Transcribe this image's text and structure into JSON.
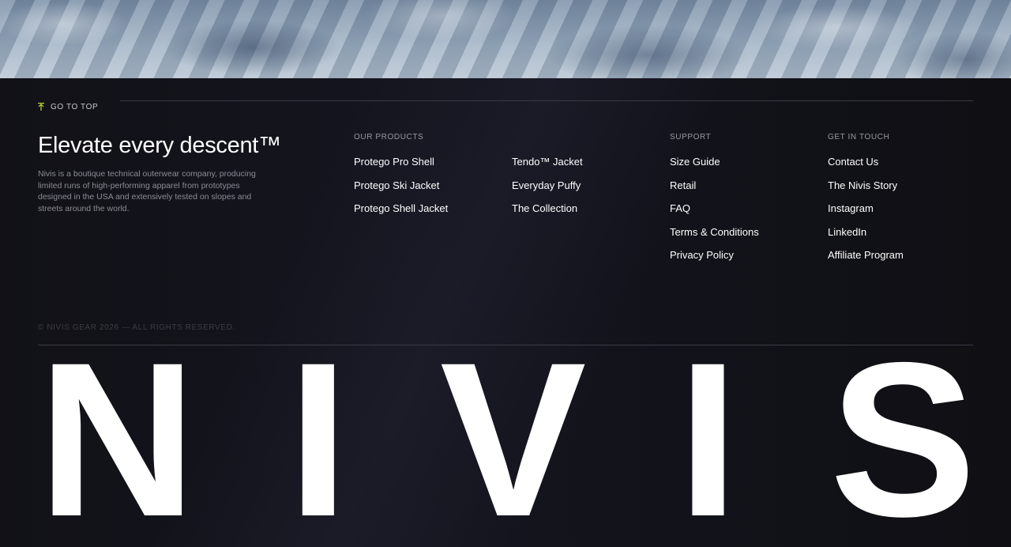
{
  "footer": {
    "go_top_label": "GO TO TOP",
    "tagline": "Elevate every descent™",
    "description": "Nivis is a boutique technical outerwear company, producing limited runs of high-performing apparel from prototypes designed in the USA and extensively tested on slopes and streets around the world.",
    "columns": {
      "products": {
        "title": "OUR PRODUCTS",
        "items": [
          "Protego Pro Shell",
          "Protego Ski Jacket",
          "Protego Shell Jacket"
        ]
      },
      "products2": {
        "items": [
          "Tendo™ Jacket",
          "Everyday Puffy",
          "The Collection"
        ]
      },
      "support": {
        "title": "SUPPORT",
        "items": [
          "Size Guide",
          "Retail",
          "FAQ",
          "Terms & Conditions",
          "Privacy Policy"
        ]
      },
      "touch": {
        "title": "GET IN TOUCH",
        "items": [
          "Contact Us",
          "The Nivis Story",
          "Instagram",
          "LinkedIn",
          "Affiliate Program"
        ]
      }
    },
    "copyright": "© NIVIS GEAR 2026 — ALL RIGHTS RESERVED.",
    "wordmark": [
      "N",
      "I",
      "V",
      "I",
      "S"
    ]
  },
  "colors": {
    "accent": "#c4d82e",
    "background": "#0f0f14"
  },
  "icons": {
    "go_top": "arrow-up-icon"
  }
}
